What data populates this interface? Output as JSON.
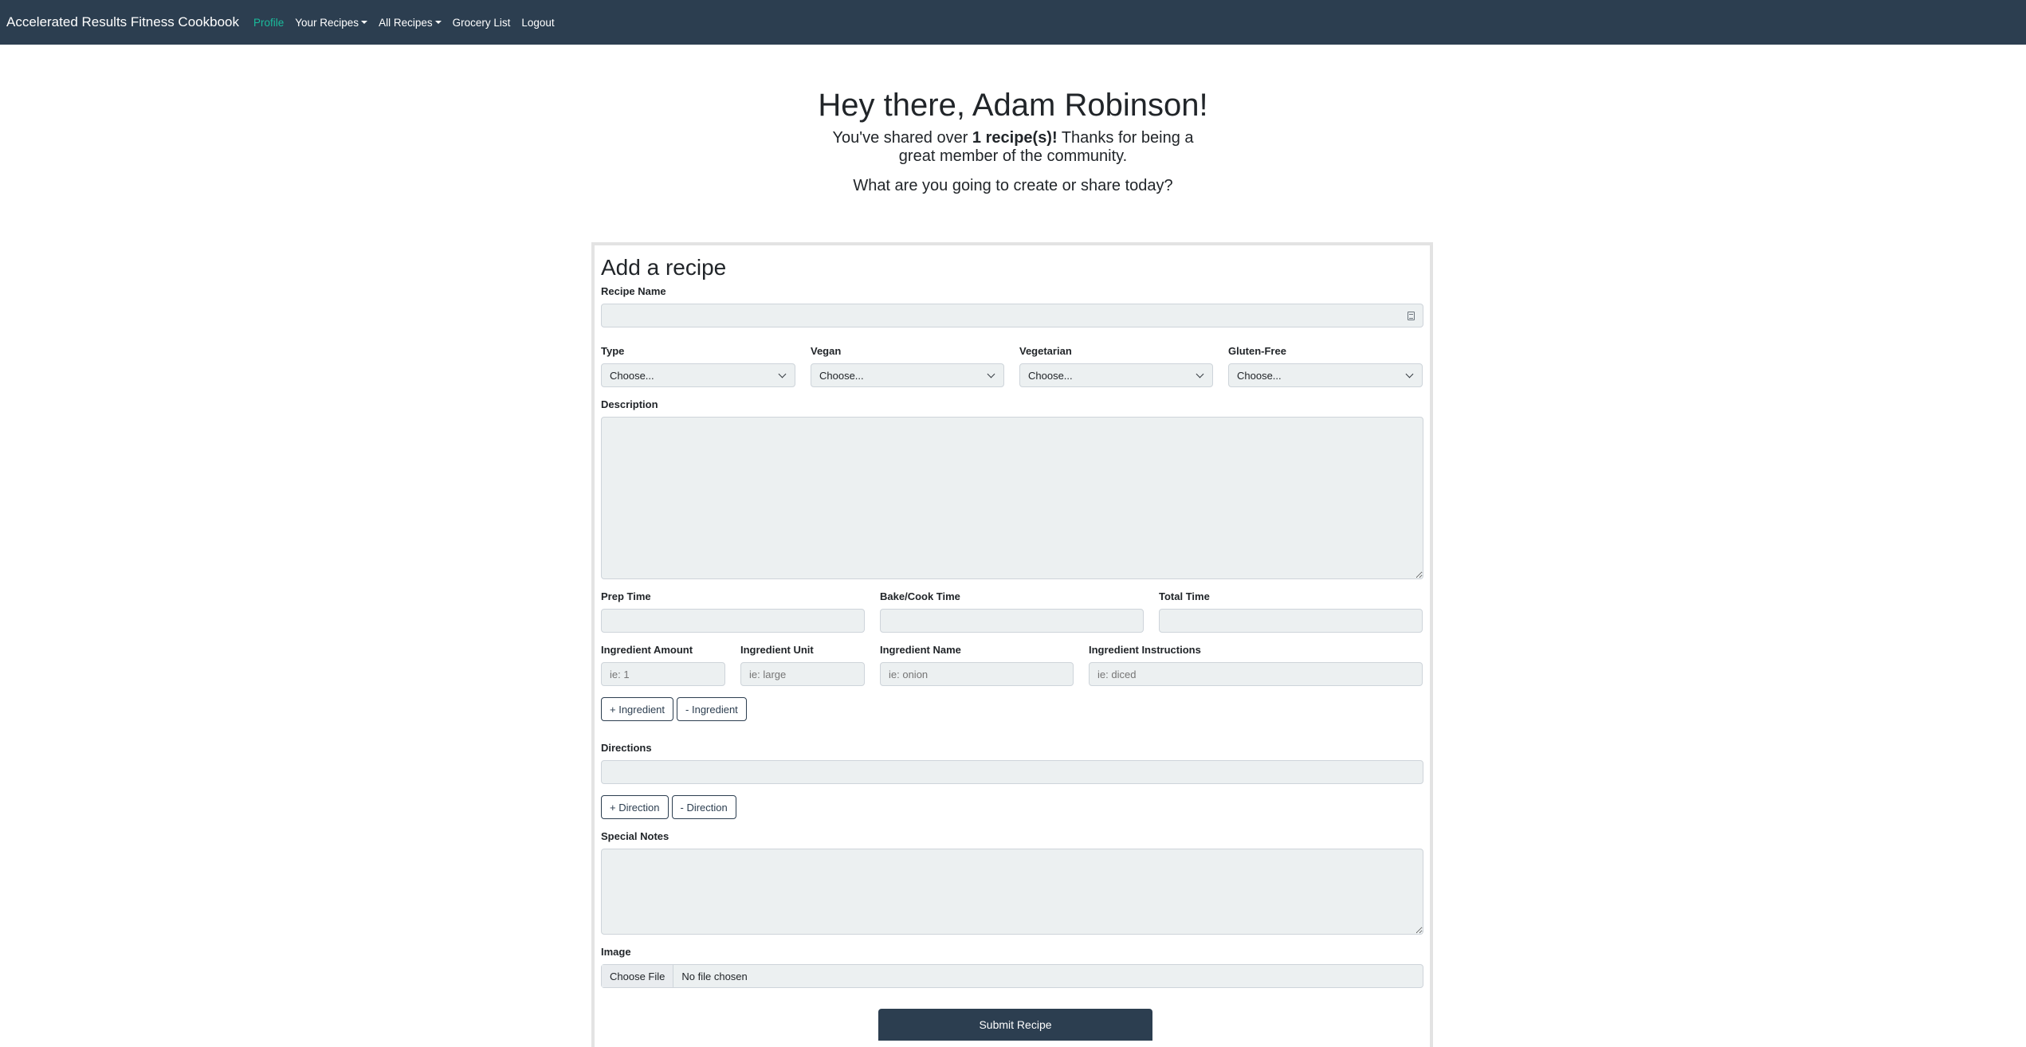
{
  "nav": {
    "brand": "Accelerated Results Fitness Cookbook",
    "items": [
      {
        "label": "Profile",
        "active": true,
        "dropdown": false
      },
      {
        "label": "Your Recipes",
        "active": false,
        "dropdown": true
      },
      {
        "label": "All Recipes",
        "active": false,
        "dropdown": true
      },
      {
        "label": "Grocery List",
        "active": false,
        "dropdown": false
      },
      {
        "label": "Logout",
        "active": false,
        "dropdown": false
      }
    ],
    "bg_color": "#2c3e50",
    "active_color": "#1abc9c"
  },
  "greeting": {
    "title": "Hey there, Adam Robinson!",
    "shared_prefix": "You've shared over ",
    "shared_count": "1 recipe(s)!",
    "shared_suffix": " Thanks for being a great member of the community.",
    "question": "What are you going to create or share today?"
  },
  "form": {
    "heading": "Add a recipe",
    "recipe_name_label": "Recipe Name",
    "recipe_name_value": "",
    "selects": [
      {
        "label": "Type",
        "value": "Choose..."
      },
      {
        "label": "Vegan",
        "value": "Choose..."
      },
      {
        "label": "Vegetarian",
        "value": "Choose..."
      },
      {
        "label": "Gluten-Free",
        "value": "Choose..."
      }
    ],
    "description_label": "Description",
    "times": [
      {
        "label": "Prep Time"
      },
      {
        "label": "Bake/Cook Time"
      },
      {
        "label": "Total Time"
      }
    ],
    "ingredients": {
      "amount_label": "Ingredient Amount",
      "amount_placeholder": "ie: 1",
      "unit_label": "Ingredient Unit",
      "unit_placeholder": "ie: large",
      "name_label": "Ingredient Name",
      "name_placeholder": "ie: onion",
      "instructions_label": "Ingredient Instructions",
      "instructions_placeholder": "ie: diced",
      "add_label": "+ Ingredient",
      "remove_label": "- Ingredient"
    },
    "directions": {
      "label": "Directions",
      "add_label": "+ Direction",
      "remove_label": "- Direction"
    },
    "special_notes_label": "Special Notes",
    "image": {
      "label": "Image",
      "button_label": "Choose File",
      "status": "No file chosen"
    },
    "submit_label": "Submit Recipe"
  }
}
